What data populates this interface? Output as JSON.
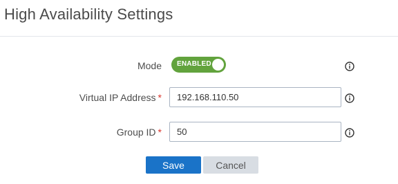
{
  "header": {
    "title": "High Availability Settings"
  },
  "form": {
    "mode": {
      "label": "Mode",
      "toggle_text": "ENABLED",
      "enabled": true,
      "toggle_color": "#62a33d"
    },
    "virtual_ip": {
      "label": "Virtual IP Address",
      "required_mark": "*",
      "value": "192.168.110.50"
    },
    "group_id": {
      "label": "Group ID",
      "required_mark": "*",
      "value": "50"
    }
  },
  "actions": {
    "save_label": "Save",
    "cancel_label": "Cancel",
    "save_color": "#1a73c8",
    "cancel_color": "#d8dde3"
  },
  "icons": {
    "info": "info-circle-icon"
  }
}
